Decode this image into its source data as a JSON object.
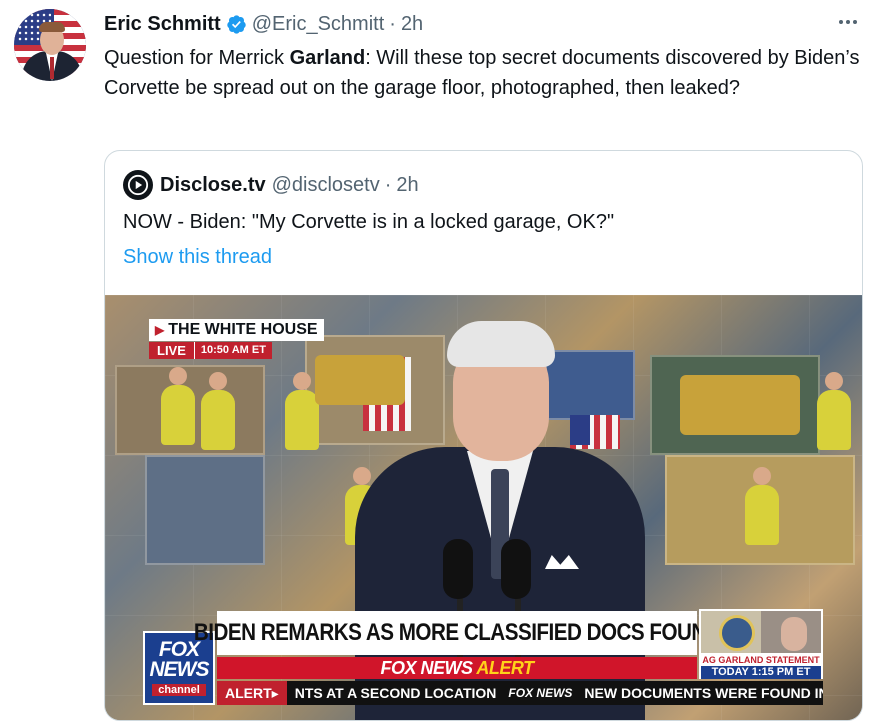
{
  "tweet": {
    "author_name": "Eric Schmitt",
    "handle": "@Eric_Schmitt",
    "separator": "·",
    "time": "2h",
    "more_icon": "more-horizontal-icon",
    "verified_icon": "verified-badge-icon",
    "text_before": "Question for Merrick ",
    "text_bold": "Garland",
    "text_after": ": Will these top secret documents discovered by Biden’s Corvette be spread out on the garage floor, photographed, then leaked?"
  },
  "quote": {
    "author_name": "Disclose.tv",
    "handle": "@disclosetv",
    "separator": "·",
    "time": "2h",
    "text": "NOW - Biden: \"My Corvette is in a locked garage, OK?\"",
    "show_thread": "Show this thread"
  },
  "media": {
    "live_location": "THE WHITE HOUSE",
    "live_badge": "LIVE",
    "live_time": "10:50 AM ET",
    "headline": "BIDEN REMARKS AS MORE CLASSIFIED DOCS FOUND",
    "alert_prefix": "FOX NEWS",
    "alert_word": "ALERT",
    "fox_logo_line1": "FOX",
    "fox_logo_line2": "NEWS",
    "fox_logo_line3": "channel",
    "ag_title": "AG GARLAND STATEMENT",
    "ag_time": "TODAY 1:15 PM ET",
    "ticker_label": "ALERT▸",
    "ticker_text1": "NTS AT A SECOND LOCATION",
    "ticker_logo": "FOX NEWS",
    "ticker_text2": "NEW DOCUMENTS WERE FOUND IN"
  },
  "colors": {
    "link": "#1d9bf0",
    "muted": "#536471",
    "verified": "#1d9bf0",
    "fox_red": "#d0152a",
    "fox_blue": "#1b3f8f"
  }
}
